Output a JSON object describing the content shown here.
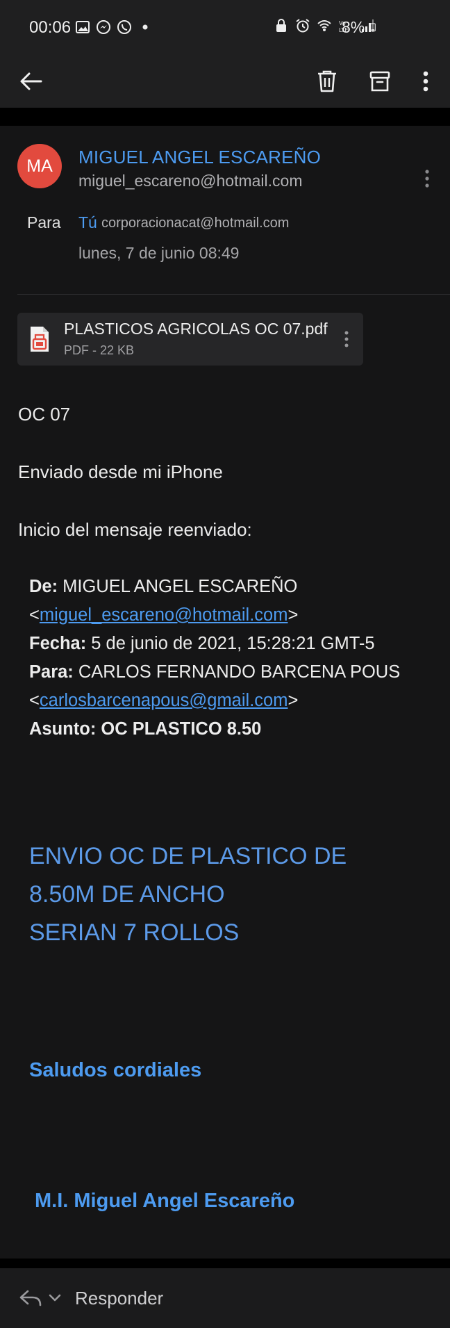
{
  "status_bar": {
    "time": "00:06",
    "battery": "8%",
    "left_icons": [
      "image-icon",
      "messenger-icon",
      "whatsapp-icon",
      "dot-icon"
    ],
    "right_icons": [
      "lock-icon",
      "alarm-icon",
      "wifi-icon",
      "volte-icon",
      "signal-icon",
      "battery-icon"
    ]
  },
  "toolbar": {
    "icons": [
      "back-arrow-icon",
      "trash-icon",
      "archive-icon",
      "more-vert-icon"
    ]
  },
  "sender": {
    "initials": "MA",
    "avatar_color": "#e24a3e",
    "name": "MIGUEL ANGEL ESCAREÑO",
    "email": "miguel_escareno@hotmail.com"
  },
  "recipients": {
    "label": "Para",
    "you": "Tú",
    "address": "corporacionacat@hotmail.com",
    "date": "lunes, 7 de junio 08:49"
  },
  "attachment": {
    "filename": "PLASTICOS AGRICOLAS OC 07.pdf",
    "meta": "PDF - 22 KB"
  },
  "body": {
    "line1": "OC 07",
    "line2": "Enviado desde mi iPhone",
    "line3": "Inicio del mensaje reenviado:",
    "forwarded": {
      "from_label": "De:",
      "from_name": " MIGUEL ANGEL ESCAREÑO",
      "from_email": "miguel_escareno@hotmail.com",
      "date_label": "Fecha:",
      "date_value": " 5 de junio de 2021, 15:28:21 GMT-5",
      "to_label": "Para:",
      "to_name": " CARLOS FERNANDO BARCENA POUS",
      "to_email": "carlosbarcenapous@gmail.com",
      "subject_label": "Asunto:",
      "subject_value": " OC PLASTICO 8.50"
    },
    "message_lines": [
      "ENVIO OC DE PLASTICO DE",
      "8.50M DE ANCHO",
      "SERIAN 7 ROLLOS"
    ],
    "greeting": "Saludos cordiales",
    "signature": "M.I. Miguel Angel Escareño"
  },
  "reply_bar": {
    "label": "Responder"
  },
  "colors": {
    "accent": "#4d9bf0",
    "background": "#151516",
    "bar": "#1f1f20"
  }
}
